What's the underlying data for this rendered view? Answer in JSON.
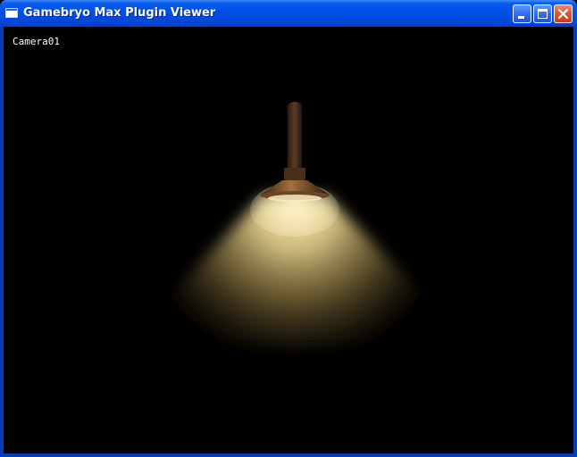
{
  "window": {
    "title": "Gamebryo Max Plugin Viewer",
    "icon": "app-window-icon",
    "controls": [
      "minimize-icon",
      "maximize-icon",
      "close-icon"
    ]
  },
  "viewport": {
    "camera_label": "Camera01",
    "scene": "spotlight-lamp-render"
  },
  "colors": {
    "title_bar": "#0050e8",
    "frame": "#0a3ab8",
    "viewport_bg": "#000000",
    "light_cone": "#e8d9a0",
    "lamp_shade": "#8a5a30",
    "close_button": "#e2522c"
  }
}
